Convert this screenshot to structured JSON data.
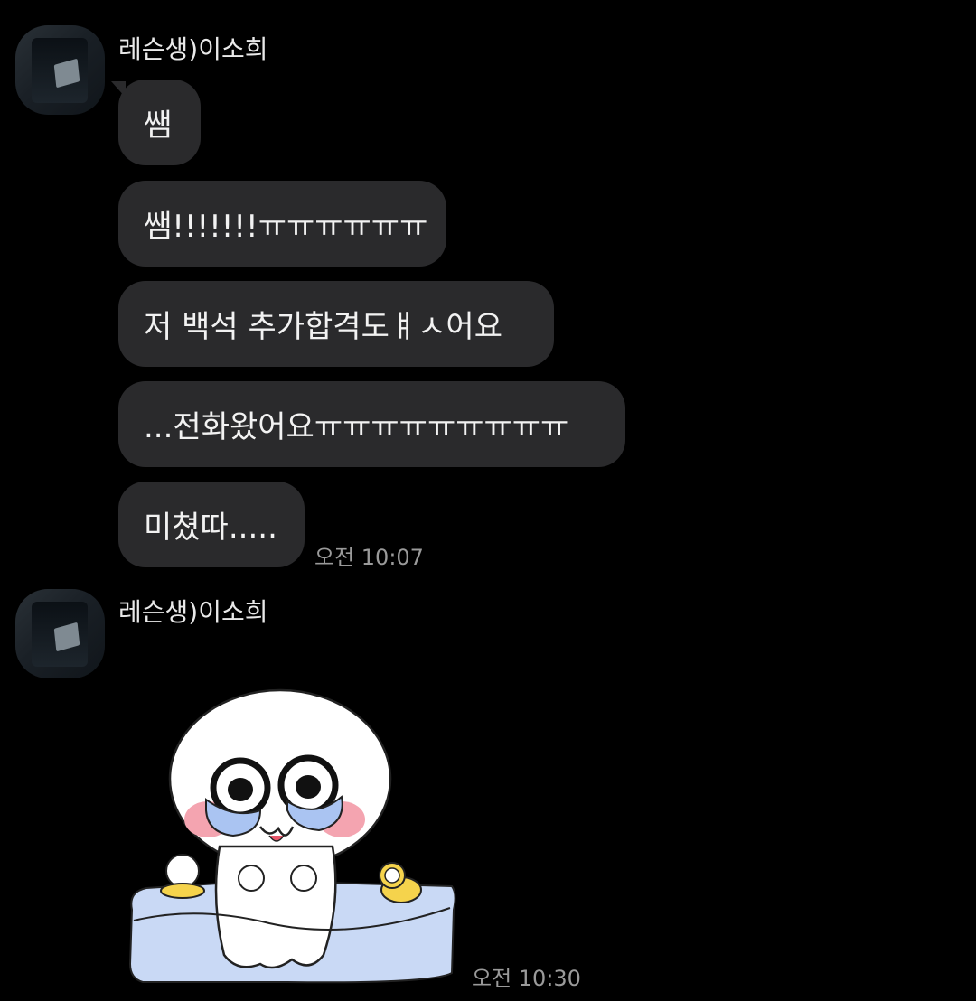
{
  "chat": {
    "groups": [
      {
        "sender": "레슨생)이소희",
        "messages": [
          "쌤",
          "쌤!!!!!!!ㅠㅠㅠㅠㅠㅠ",
          "저 백석 추가합격도ㅒㅅ어요",
          "...전화왔어요ㅠㅠㅠㅠㅠㅠㅠㅠㅠ",
          "미쳤따....."
        ],
        "time": "오전 10:07"
      },
      {
        "sender": "레슨생)이소희",
        "sticker": "crying-bath-character-sticker",
        "time": "오전 10:30"
      }
    ]
  },
  "colors": {
    "background": "#000000",
    "bubble": "#2a2a2c",
    "text": "#f2f2f2",
    "timestamp": "#9a9a9a"
  }
}
